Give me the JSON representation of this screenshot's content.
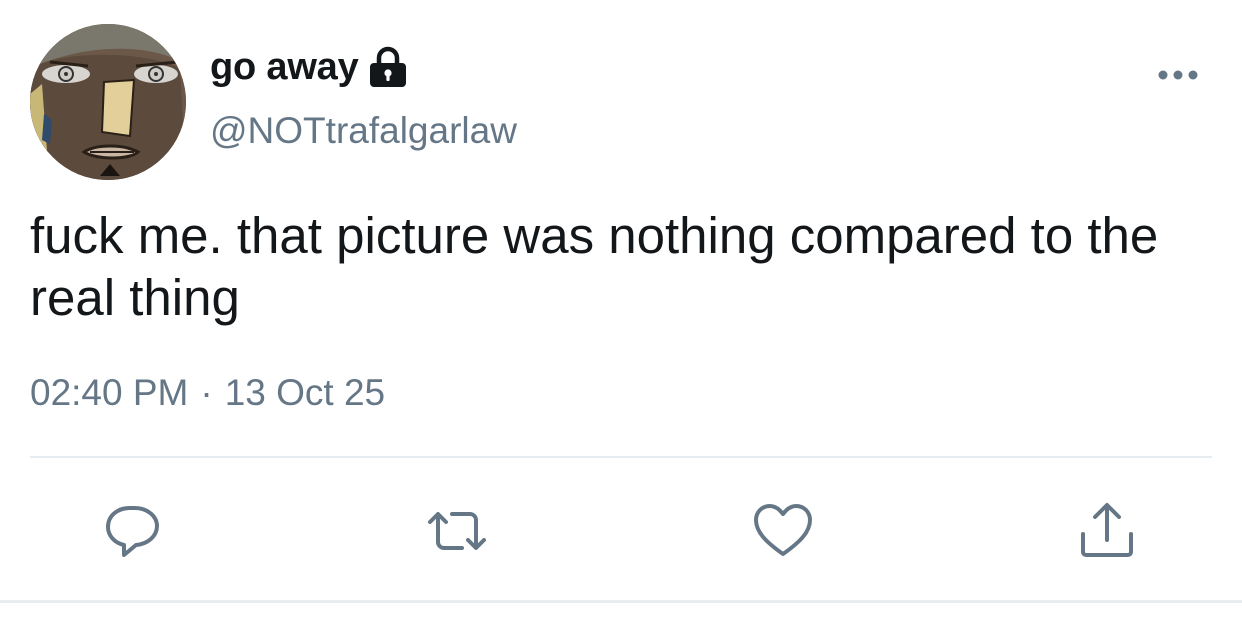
{
  "tweet": {
    "author": {
      "display_name": "go away",
      "handle": "@NOTtrafalgarlaw",
      "avatar_icon": "anime-character-avatar",
      "protected_icon": "lock-icon"
    },
    "text": "fuck me. that picture was nothing compared to the real thing",
    "time": "02:40 PM",
    "separator": "·",
    "date": "13 Oct 25",
    "more_icon": "more-options-icon",
    "actions": [
      {
        "name": "reply",
        "icon": "reply-icon"
      },
      {
        "name": "retweet",
        "icon": "retweet-icon"
      },
      {
        "name": "like",
        "icon": "heart-icon"
      },
      {
        "name": "share",
        "icon": "share-icon"
      }
    ]
  },
  "colors": {
    "text_primary": "#14171a",
    "text_secondary": "#657786",
    "icon": "#657786",
    "divider": "#e6ecf0"
  }
}
